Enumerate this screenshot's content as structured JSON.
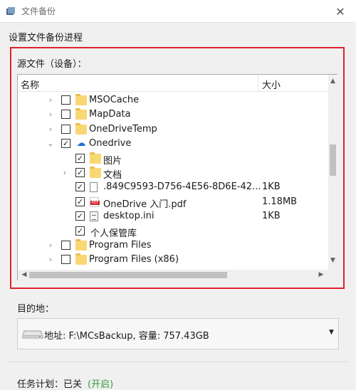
{
  "window": {
    "title": "文件备份",
    "close_glyph": "✕"
  },
  "section_title": "设置文件备份进程",
  "source_label": "源文件（设备）：",
  "columns": {
    "name": "名称",
    "size": "大小"
  },
  "tree_rows": [
    {
      "name": "MSOCache",
      "size": "",
      "icon": "folder-icon",
      "checked": false,
      "expander": "›"
    },
    {
      "name": "MapData",
      "size": "",
      "icon": "folder-icon",
      "checked": false,
      "expander": "›"
    },
    {
      "name": "OneDriveTemp",
      "size": "",
      "icon": "folder-icon",
      "checked": false,
      "expander": "›"
    },
    {
      "name": "Onedrive",
      "size": "",
      "icon": "cloud-icon",
      "checked": true,
      "expander": "⌄"
    },
    {
      "name": "图片",
      "size": "",
      "icon": "folder-icon",
      "checked": true,
      "expander": ""
    },
    {
      "name": "文档",
      "size": "",
      "icon": "folder-icon",
      "checked": true,
      "expander": "›"
    },
    {
      "name": ".849C9593-D756-4E56-8D6E-42...",
      "size": "1KB",
      "icon": "file-icon",
      "checked": true,
      "expander": ""
    },
    {
      "name": "OneDrive 入门.pdf",
      "size": "1.18MB",
      "icon": "pdf-icon",
      "checked": true,
      "expander": ""
    },
    {
      "name": "desktop.ini",
      "size": "1KB",
      "icon": "ini-file-icon",
      "checked": true,
      "expander": ""
    },
    {
      "name": "个人保管库",
      "size": "",
      "icon": "",
      "checked": true,
      "expander": ""
    },
    {
      "name": "Program Files",
      "size": "",
      "icon": "folder-icon",
      "checked": false,
      "expander": "›"
    },
    {
      "name": "Program Files (x86)",
      "size": "",
      "icon": "folder-icon",
      "checked": false,
      "expander": "›"
    }
  ],
  "check_glyph": "✓",
  "scroll_glyphs": {
    "up": "▲",
    "down": "▼",
    "left": "◀",
    "right": "▶"
  },
  "destination": {
    "label": "目的地：",
    "value": "地址: F:\\MCsBackup, 容量: 757.43GB",
    "arrow": "▼"
  },
  "task": {
    "label": "任务计划：已关",
    "link": "(开启)"
  },
  "colors": {
    "highlight_frame": "#e0202e",
    "link_green": "#2f9e3a",
    "onedrive_blue": "#1e6fd6"
  }
}
